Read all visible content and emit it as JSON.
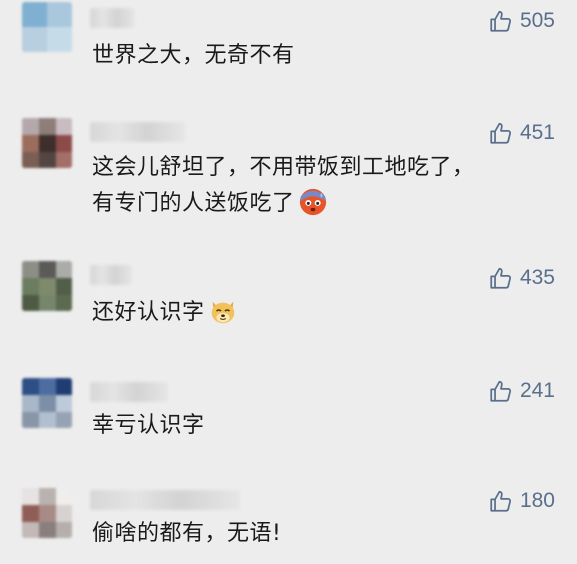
{
  "comments": [
    {
      "likes": "505",
      "lines": [
        "世界之大，无奇不有"
      ]
    },
    {
      "likes": "451",
      "lines": [
        "这会儿舒坦了，不用带饭到工地吃了，",
        "有专门的人送饭吃了"
      ],
      "emoji": "cold-sweat-face-emoji"
    },
    {
      "likes": "435",
      "lines": [
        "还好认识字"
      ],
      "emoji": "dog-face-emoji"
    },
    {
      "likes": "241",
      "lines": [
        "幸亏认识字"
      ]
    },
    {
      "likes": "180",
      "lines": [
        "偷啥的都有，无语!"
      ]
    }
  ],
  "icons": {
    "like": "thumbs-up-icon"
  },
  "colors": {
    "background": "#ededed",
    "like_text": "#5a6f8c",
    "comment_text": "#1a1a1a"
  }
}
